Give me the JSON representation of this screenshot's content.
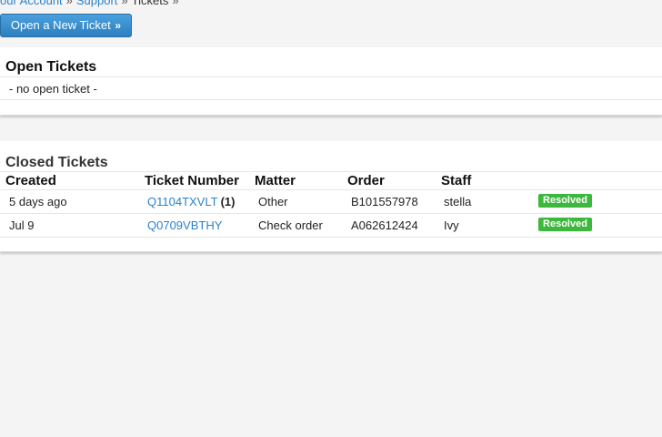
{
  "breadcrumb": {
    "items": [
      "our Account",
      "Support",
      "Tickets"
    ],
    "separator": "»"
  },
  "toolbar": {
    "new_ticket_label": "Open a New Ticket",
    "new_ticket_suffix": "»"
  },
  "open_tickets": {
    "title": "Open Tickets",
    "empty_text": "- no open ticket -"
  },
  "closed_tickets": {
    "title": "Closed Tickets",
    "columns": [
      "Created",
      "Ticket Number",
      "Matter",
      "Order",
      "Staff"
    ],
    "rows": [
      {
        "created": "5 days ago",
        "ticket_number": "Q1104TXVLT",
        "reply_count": "(1)",
        "matter": "Other",
        "order": "B101557978",
        "staff": "stella",
        "status": "Resolved"
      },
      {
        "created": "Jul 9",
        "ticket_number": "Q0709VBTHY",
        "reply_count": "",
        "matter": "Check order",
        "order": "A062612424",
        "staff": "Ivy",
        "status": "Resolved"
      }
    ]
  },
  "colors": {
    "link": "#2b82c9",
    "button": "#3a8fd0",
    "resolved_badge": "#3cb83c",
    "background": "#f4f4f4"
  }
}
